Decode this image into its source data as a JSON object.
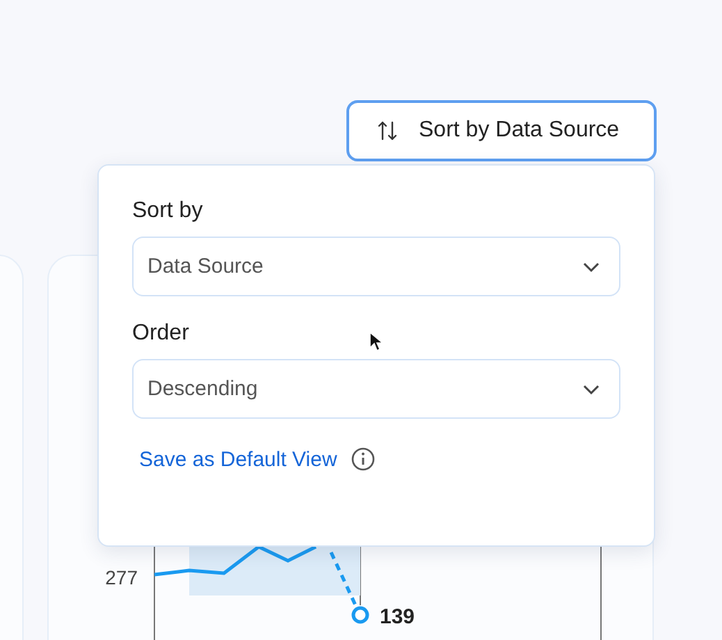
{
  "sort_button": {
    "label": "Sort by Data Source"
  },
  "popover": {
    "fields": [
      {
        "label": "Sort by",
        "value": "Data Source"
      },
      {
        "label": "Order",
        "value": "Descending"
      }
    ],
    "save_link": "Save as Default View"
  },
  "chart": {
    "y_label": "277",
    "point_label": "139"
  }
}
